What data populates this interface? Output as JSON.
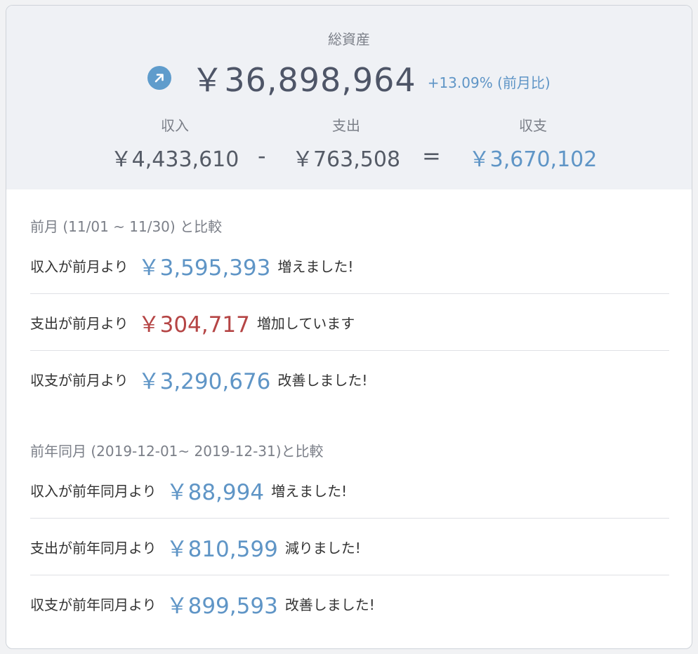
{
  "summary": {
    "total_label": "総資産",
    "total_value": "￥36,898,964",
    "total_change": "+13.09% (前月比)",
    "trend_icon": "arrow-up-right-icon",
    "income_label": "収入",
    "income_value": "￥4,433,610",
    "minus": "-",
    "expense_label": "支出",
    "expense_value": "￥763,508",
    "equals": "=",
    "balance_label": "収支",
    "balance_value": "￥3,670,102"
  },
  "colors": {
    "accent": "#5f95c6",
    "negative": "#b54545",
    "header_bg": "#eff1f5"
  },
  "comparisons": [
    {
      "title": "前月 (11/01 ~ 11/30) と比較",
      "rows": [
        {
          "prefix": "収入が前月より",
          "amount": "￥3,595,393",
          "suffix": "増えました!",
          "tone": "positive"
        },
        {
          "prefix": "支出が前月より",
          "amount": "￥304,717",
          "suffix": "増加しています",
          "tone": "negative"
        },
        {
          "prefix": "収支が前月より",
          "amount": "￥3,290,676",
          "suffix": "改善しました!",
          "tone": "positive"
        }
      ]
    },
    {
      "title": "前年同月 (2019-12-01~ 2019-12-31)と比較",
      "rows": [
        {
          "prefix": "収入が前年同月より",
          "amount": "￥88,994",
          "suffix": "増えました!",
          "tone": "positive"
        },
        {
          "prefix": "支出が前年同月より",
          "amount": "￥810,599",
          "suffix": "減りました!",
          "tone": "positive"
        },
        {
          "prefix": "収支が前年同月より",
          "amount": "￥899,593",
          "suffix": "改善しました!",
          "tone": "positive"
        }
      ]
    }
  ]
}
